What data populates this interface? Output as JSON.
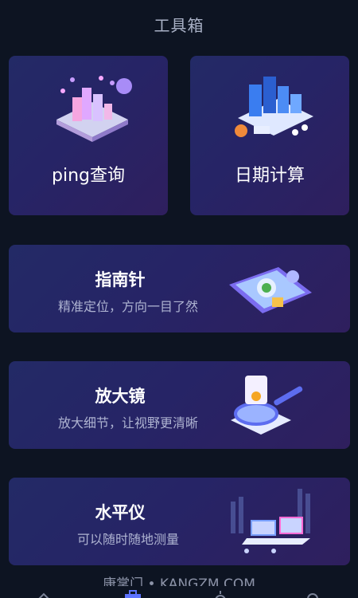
{
  "header": {
    "title": "工具箱"
  },
  "tools": {
    "ping": {
      "label": "ping查询"
    },
    "date": {
      "label": "日期计算"
    },
    "compass": {
      "title": "指南针",
      "desc": "精准定位，方向一目了然"
    },
    "magnifier": {
      "title": "放大镜",
      "desc": "放大细节，让视野更清晰"
    },
    "level": {
      "title": "水平仪",
      "desc": "可以随时随地测量"
    }
  },
  "watermark": "康掌门 • KANGZM.COM",
  "icons": {
    "ping": "city-network-icon",
    "date": "calendar-data-icon",
    "compass": "phone-map-icon",
    "magnifier": "magnifier-icon",
    "level": "device-level-icon"
  },
  "colors": {
    "background": "#0d1422",
    "card_start": "#232a66",
    "card_end": "#2f1f5e",
    "accent": "#6a7bff"
  }
}
